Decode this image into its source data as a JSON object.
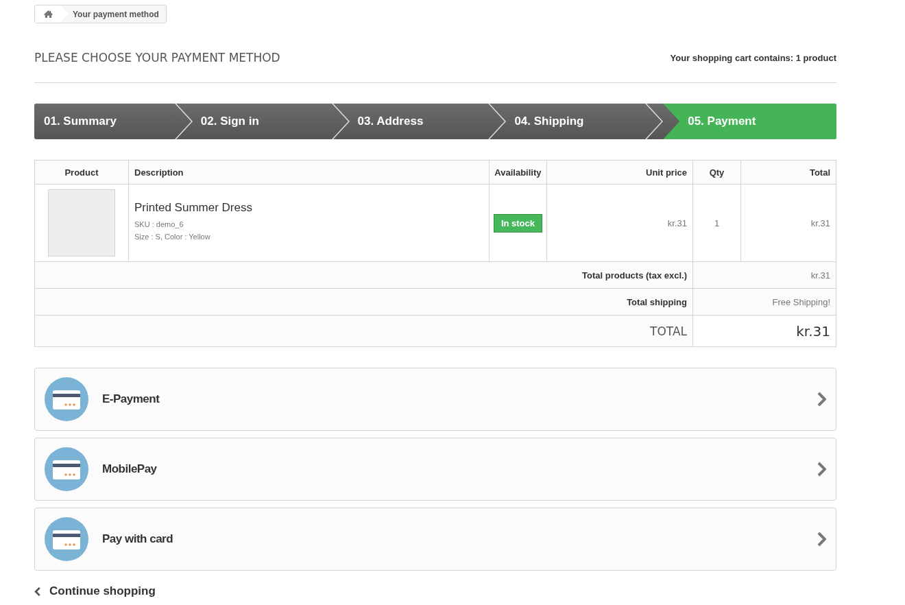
{
  "breadcrumb": {
    "label": "Your payment method"
  },
  "heading": "PLEASE CHOOSE YOUR PAYMENT METHOD",
  "cart_summary": "Your shopping cart contains: 1 product",
  "steps": [
    {
      "label": "01. Summary",
      "selected": false
    },
    {
      "label": "02. Sign in",
      "selected": false
    },
    {
      "label": "03. Address",
      "selected": false
    },
    {
      "label": "04. Shipping",
      "selected": false
    },
    {
      "label": "05. Payment",
      "selected": true
    }
  ],
  "table": {
    "columns": [
      "Product",
      "Description",
      "Availability",
      "Unit price",
      "Qty",
      "Total"
    ],
    "rows": [
      {
        "name": "Printed Summer Dress",
        "sku": "SKU : demo_6",
        "attributes": "Size : S, Color : Yellow",
        "availability": "In stock",
        "unit_price": "kr.31",
        "qty": "1",
        "total": "kr.31"
      }
    ],
    "summary": [
      {
        "kind": "line",
        "label": "Total products (tax excl.)",
        "value": "kr.31"
      },
      {
        "kind": "line",
        "label": "Total shipping",
        "value": "Free Shipping!"
      },
      {
        "kind": "grand",
        "label": "TOTAL",
        "value": "kr.31"
      }
    ]
  },
  "payment_options": [
    {
      "label": "E-Payment"
    },
    {
      "label": "MobilePay"
    },
    {
      "label": "Pay with card"
    }
  ],
  "continue_shopping": "Continue shopping"
}
